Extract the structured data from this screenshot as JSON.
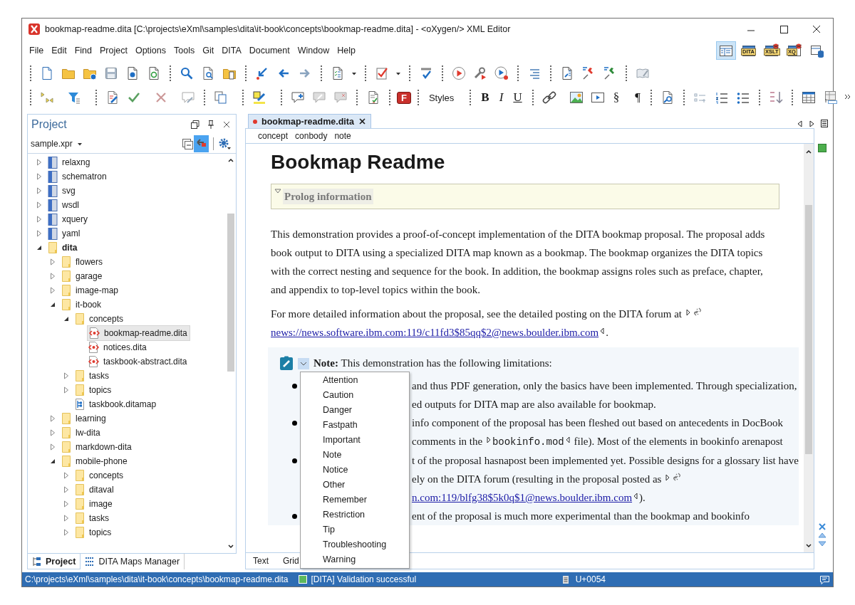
{
  "window": {
    "title": "bookmap-readme.dita [C:\\projects\\eXml\\samples\\dita\\it-book\\concepts\\bookmap-readme.dita] - <oXygen/> XML Editor"
  },
  "menu": [
    "File",
    "Edit",
    "Find",
    "Project",
    "Options",
    "Tools",
    "Git",
    "DITA",
    "Document",
    "Window",
    "Help"
  ],
  "perspectives": [
    {
      "kind": "editor",
      "selected": true
    },
    {
      "kind": "dita",
      "label": "DITA",
      "selected": false
    },
    {
      "kind": "xslt",
      "label": "XSLT",
      "selected": false
    },
    {
      "kind": "xquery",
      "label": "XQ",
      "selected": false
    },
    {
      "kind": "database",
      "selected": false
    }
  ],
  "format_toolbar": {
    "font_button": "F",
    "styles": "Styles",
    "bold": "B",
    "italic": "I",
    "underline": "U",
    "section": "§",
    "pilcrow": "¶"
  },
  "project_panel": {
    "title": "Project",
    "project_file": "sample.xpr",
    "tree": [
      {
        "label": "relaxng",
        "kind": "module",
        "expanded": false,
        "selected": false,
        "emphasized": false
      },
      {
        "label": "schematron",
        "kind": "module",
        "expanded": false,
        "selected": false,
        "emphasized": false
      },
      {
        "label": "svg",
        "kind": "module",
        "expanded": false,
        "selected": false,
        "emphasized": false
      },
      {
        "label": "wsdl",
        "kind": "module",
        "expanded": false,
        "selected": false,
        "emphasized": false
      },
      {
        "label": "xquery",
        "kind": "module",
        "expanded": false,
        "selected": false,
        "emphasized": false
      },
      {
        "label": "yaml",
        "kind": "module",
        "expanded": false,
        "selected": false,
        "emphasized": false
      },
      {
        "label": "dita",
        "kind": "folder",
        "expanded": true,
        "selected": false,
        "emphasized": true,
        "children": [
          {
            "label": "flowers",
            "kind": "folder",
            "expanded": false,
            "selected": false,
            "emphasized": false
          },
          {
            "label": "garage",
            "kind": "folder",
            "expanded": false,
            "selected": false,
            "emphasized": false
          },
          {
            "label": "image-map",
            "kind": "folder",
            "expanded": false,
            "selected": false,
            "emphasized": false
          },
          {
            "label": "it-book",
            "kind": "folder",
            "expanded": true,
            "selected": false,
            "emphasized": false,
            "children": [
              {
                "label": "concepts",
                "kind": "folder",
                "expanded": true,
                "selected": false,
                "emphasized": false,
                "children": [
                  {
                    "label": "bookmap-readme.dita",
                    "kind": "topic",
                    "selected": true,
                    "emphasized": false
                  },
                  {
                    "label": "notices.dita",
                    "kind": "topic",
                    "selected": false,
                    "emphasized": false
                  },
                  {
                    "label": "taskbook-abstract.dita",
                    "kind": "topic",
                    "selected": false,
                    "emphasized": false
                  }
                ]
              },
              {
                "label": "tasks",
                "kind": "folder",
                "expanded": false,
                "selected": false,
                "emphasized": false
              },
              {
                "label": "topics",
                "kind": "folder",
                "expanded": false,
                "selected": false,
                "emphasized": false
              },
              {
                "label": "taskbook.ditamap",
                "kind": "map",
                "selected": false,
                "emphasized": false
              }
            ]
          },
          {
            "label": "learning",
            "kind": "folder",
            "expanded": false,
            "selected": false,
            "emphasized": false
          },
          {
            "label": "lw-dita",
            "kind": "folder",
            "expanded": false,
            "selected": false,
            "emphasized": false
          },
          {
            "label": "markdown-dita",
            "kind": "folder",
            "expanded": false,
            "selected": false,
            "emphasized": false
          },
          {
            "label": "mobile-phone",
            "kind": "folder",
            "expanded": true,
            "selected": false,
            "emphasized": false,
            "children": [
              {
                "label": "concepts",
                "kind": "folder",
                "expanded": false,
                "selected": false,
                "emphasized": false
              },
              {
                "label": "ditaval",
                "kind": "folder",
                "expanded": false,
                "selected": false,
                "emphasized": false
              },
              {
                "label": "image",
                "kind": "folder",
                "expanded": false,
                "selected": false,
                "emphasized": false
              },
              {
                "label": "tasks",
                "kind": "folder",
                "expanded": false,
                "selected": false,
                "emphasized": false
              },
              {
                "label": "topics",
                "kind": "folder",
                "expanded": false,
                "selected": false,
                "emphasized": false
              }
            ]
          }
        ]
      }
    ],
    "bottom_tabs": [
      {
        "label": "Project",
        "selected": true
      },
      {
        "label": "DITA Maps Manager",
        "selected": false
      }
    ]
  },
  "editor": {
    "tab": {
      "label": "bookmap-readme.dita",
      "modified": true
    },
    "breadcrumb": [
      "concept",
      "conbody",
      "note"
    ],
    "heading": "Bookmap Readme",
    "prolog": "Prolog information",
    "paragraphs": [
      [
        {
          "kind": "text",
          "text": "This demonstration provides a proof-of-concept implementation of the DITA bookmap proposal. The proposal adds book output to DITA using a specialized DITA map known as a bookmap. The bookmap organizes the DITA topics with the correct nesting and sequence for the book. In addition, the bookmap assigns roles such as preface, chapter, and appendix to top-level topics within the book."
        }
      ],
      [
        {
          "kind": "text",
          "text": "For more detailed information about the proposal, see the detailed posting on the DITA forum at "
        },
        {
          "kind": "tag_start"
        },
        {
          "kind": "link_icon"
        },
        {
          "kind": "link",
          "text": "news://news.software.ibm.com:119/c11fd3$85qq$2@news.boulder.ibm.com"
        },
        {
          "kind": "tag_end"
        },
        {
          "kind": "text",
          "text": "."
        }
      ]
    ],
    "note": {
      "header": "**Note:** This demonstration has the following limitations:",
      "bullets": [
        {
          "lines": [
            [
              {
                "kind": "text",
                "text": "and thus PDF generation, only the basics have been implemented. Through specialization,"
              }
            ],
            [
              {
                "kind": "text",
                "text": "ed outputs for DITA map are also available for bookmap."
              }
            ]
          ]
        },
        {
          "lines": [
            [
              {
                "kind": "text",
                "text": "info component of the proposal has been fleshed out based on antecedents in DocBook"
              }
            ],
            [
              {
                "kind": "text",
                "text": "comments in the "
              },
              {
                "kind": "tag_start"
              },
              {
                "kind": "code",
                "text": "bookinfo.mod"
              },
              {
                "kind": "tag_end"
              },
              {
                "kind": "text",
                "text": " file). Most of the elements in bookinfo arenapost"
              }
            ]
          ]
        },
        {
          "lines": [
            [
              {
                "kind": "text",
                "text": "t of the proposal hasnapost been implemented yet. Possible designs for a glossary list have"
              }
            ],
            [
              {
                "kind": "text",
                "text": "ely on the DITA forum (resulting in the proposal posted as "
              },
              {
                "kind": "tag_start"
              },
              {
                "kind": "link_icon"
              }
            ],
            [
              {
                "kind": "link",
                "text": "n.com:119/blfg38$5k0q$1@news.boulder.ibm.com"
              },
              {
                "kind": "tag_end"
              },
              {
                "kind": "text",
                "text": ")."
              }
            ]
          ]
        },
        {
          "lines": [
            [
              {
                "kind": "text",
                "text": "ent of the proposal is much more experimental than the bookmap and bookinfo"
              }
            ]
          ]
        }
      ]
    },
    "mode_tabs": [
      "Text",
      "Grid"
    ]
  },
  "note_type_menu": [
    "Attention",
    "Caution",
    "Danger",
    "Fastpath",
    "Important",
    "Note",
    "Notice",
    "Other",
    "Remember",
    "Restriction",
    "Tip",
    "Troubleshooting",
    "Warning"
  ],
  "status_bar": {
    "path": "C:\\projects\\eXml\\samples\\dita\\it-book\\concepts\\bookmap-readme.dita",
    "validation": "[DITA] Validation successful",
    "character": "U+0054"
  }
}
